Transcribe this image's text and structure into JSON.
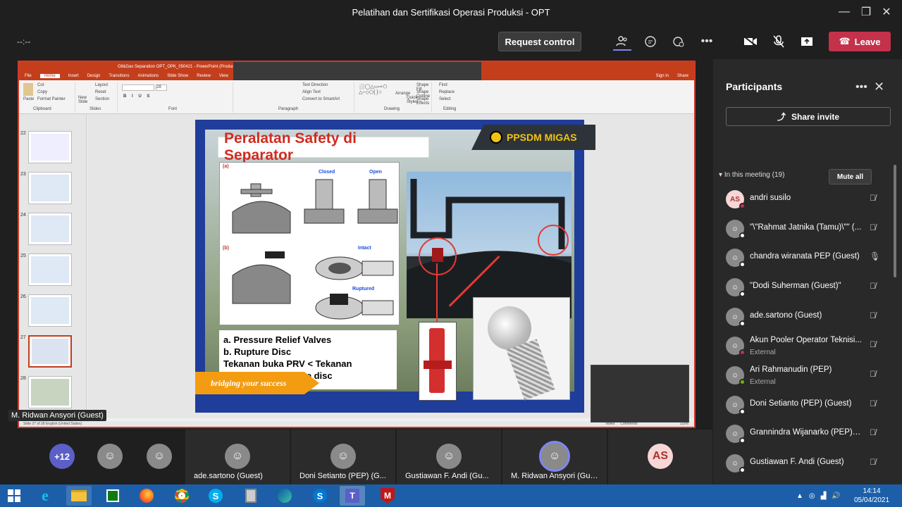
{
  "window": {
    "title": "Pelatihan dan Sertifikasi Operasi Produksi - OPT",
    "min_icon": "—",
    "max_icon": "❐",
    "close_icon": "✕"
  },
  "toolbar": {
    "timer": "--:--",
    "request_control": "Request control",
    "leave": "Leave",
    "icons": {
      "participants": "participants-icon",
      "chat": "chat-icon",
      "reactions": "raise-hand-icon",
      "more": "•••",
      "camera": "camera-off-icon",
      "mic": "mic-off-icon",
      "share": "share-icon"
    },
    "colors": {
      "leave": "#c4314b"
    }
  },
  "ppt": {
    "title": "Oil&Gas Separation OPT_OPK_050421 - PowerPoint (Product A...",
    "tabs": [
      "File",
      "Home",
      "Insert",
      "Design",
      "Transitions",
      "Animations",
      "Slide Show",
      "Review",
      "View"
    ],
    "right_tabs": [
      "Sign in",
      "Share"
    ],
    "ribbon": {
      "clipboard": {
        "label": "Clipboard",
        "items": [
          "Cut",
          "Copy",
          "Format Painter",
          "Paste"
        ]
      },
      "slides": {
        "label": "Slides",
        "items": [
          "Layout",
          "Reset",
          "Section",
          "New Slide"
        ]
      },
      "font": {
        "label": "Font",
        "size": "28"
      },
      "paragraph": {
        "label": "Paragraph",
        "items": [
          "Text Direction",
          "Align Text",
          "Convert to SmartArt"
        ]
      },
      "drawing": {
        "label": "Drawing",
        "items": [
          "Arrange",
          "Quick Styles",
          "Shape Fill",
          "Shape Outline",
          "Shape Effects"
        ]
      },
      "editing": {
        "label": "Editing",
        "items": [
          "Find",
          "Replace",
          "Select"
        ]
      }
    },
    "thumbnails": [
      "22",
      "23",
      "24",
      "25",
      "26",
      "27",
      "28"
    ],
    "status": {
      "left": "Slide 27 of 28    English (United States)",
      "notes": "Notes",
      "comments": "Comments",
      "zoom": "115%"
    }
  },
  "slide": {
    "title": "Peralatan Safety di Separator",
    "logo": "PPSDM MIGAS",
    "diagram_labels": {
      "a": "(a)",
      "b": "(b)",
      "closed": "Closed",
      "open": "Open",
      "intact": "Intact",
      "ruptured": "Ruptured"
    },
    "lines": [
      "a.  Pressure Relief Valves",
      "b.  Rupture Disc",
      "Tekanan buka PRV < Tekanan",
      "buka/pecah Rupture disc"
    ],
    "banner": "bridging your success"
  },
  "presenter_caption": "M. Ridwan Ansyori (Guest)",
  "gallery": {
    "overflow": "+12",
    "tiles": [
      {
        "name": "ade.sartono (Guest)"
      },
      {
        "name": "Doni Setianto (PEP) (G..."
      },
      {
        "name": "Gustiawan F. Andi (Gu..."
      },
      {
        "name": "M. Ridwan Ansyori (Guest)"
      },
      {
        "initials": "AS"
      }
    ]
  },
  "participants": {
    "title": "Participants",
    "share_invite": "Share invite",
    "in_meeting": "In this meeting (19)",
    "mute_all": "Mute all",
    "list": [
      {
        "name": "andri susilo",
        "initials": "AS",
        "mic": "muted",
        "status": "busy"
      },
      {
        "name": "\"\\\"Rahmat Jatnika (Tamu)\\\"\" (...",
        "initials": "",
        "mic": "muted",
        "status": "offline"
      },
      {
        "name": "chandra wiranata PEP (Guest)",
        "initials": "",
        "mic": "on",
        "status": "offline"
      },
      {
        "name": "\"Dodi Suherman (Guest)\"",
        "initials": "",
        "mic": "muted",
        "status": "offline"
      },
      {
        "name": "ade.sartono (Guest)",
        "initials": "",
        "mic": "muted",
        "status": "offline"
      },
      {
        "name": "Akun Pooler Operator Teknisi...",
        "sub": "External",
        "initials": "",
        "mic": "muted",
        "status": "busy"
      },
      {
        "name": "Ari Rahmanudin (PEP)",
        "sub": "External",
        "initials": "",
        "mic": "muted",
        "status": "available"
      },
      {
        "name": "Doni Setianto (PEP) (Guest)",
        "initials": "",
        "mic": "muted",
        "status": "offline"
      },
      {
        "name": "Grannindra Wijanarko (PEP) (...",
        "initials": "",
        "mic": "muted",
        "status": "offline"
      },
      {
        "name": "Gustiawan F. Andi (Guest)",
        "initials": "",
        "mic": "muted",
        "status": "offline"
      }
    ],
    "status_colors": {
      "busy": "#c4314b",
      "available": "#6bb700",
      "offline": "#ffffff"
    }
  },
  "taskbar": {
    "apps": [
      "windows-start-icon",
      "internet-explorer-icon",
      "file-explorer-icon",
      "store-icon",
      "firefox-icon",
      "chrome-icon",
      "skype-icon",
      "calculator-icon",
      "edge-icon",
      "skype-business-icon",
      "teams-icon",
      "mcafee-icon"
    ],
    "time": "14:14",
    "date": "05/04/2021"
  }
}
